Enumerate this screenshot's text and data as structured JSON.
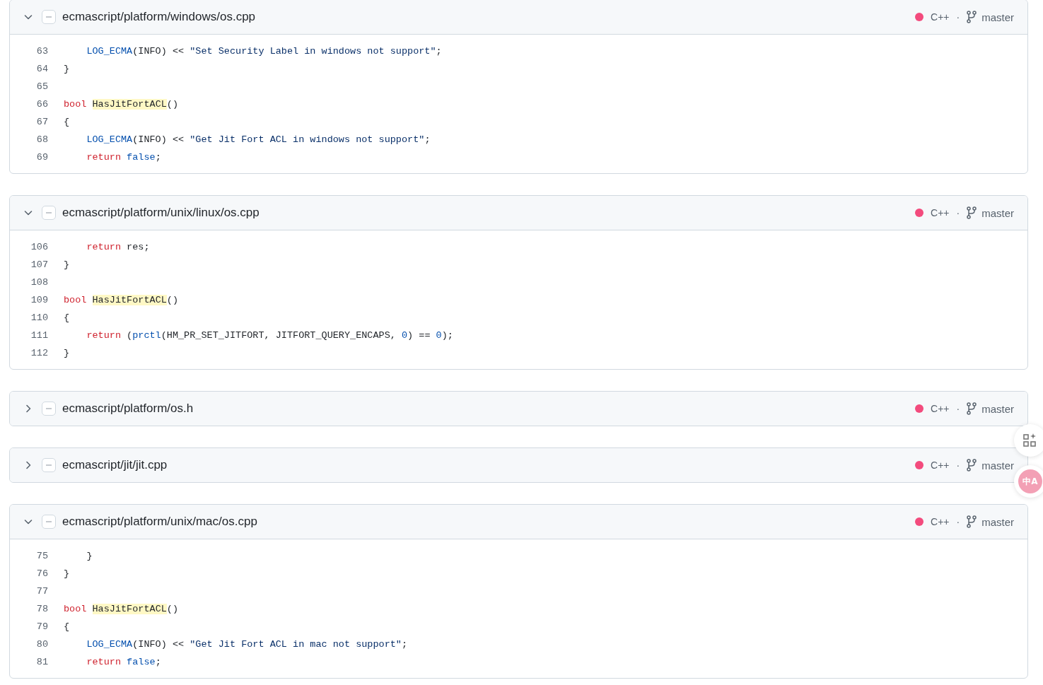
{
  "results": [
    {
      "path": "ecmascript/platform/windows/os.cpp",
      "expanded": true,
      "language": "C++",
      "separator": "·",
      "branch": "master",
      "lines": [
        {
          "number": "63",
          "indented": true,
          "tokens": [
            {
              "kind": "func",
              "text": "LOG_ECMA"
            },
            {
              "kind": "plain",
              "text": "(INFO) << "
            },
            {
              "kind": "string",
              "text": "\"Set Security Label in windows not support\""
            },
            {
              "kind": "plain",
              "text": ";"
            }
          ]
        },
        {
          "number": "64",
          "indented": false,
          "tokens": [
            {
              "kind": "plain",
              "text": "}"
            }
          ]
        },
        {
          "number": "65"
        },
        {
          "number": "66",
          "indented": false,
          "tokens": [
            {
              "kind": "keyword",
              "text": "bool "
            },
            {
              "kind": "match",
              "text": "HasJitFortACL"
            },
            {
              "kind": "plain",
              "text": "()"
            }
          ]
        },
        {
          "number": "67",
          "indented": false,
          "tokens": [
            {
              "kind": "plain",
              "text": "{"
            }
          ]
        },
        {
          "number": "68",
          "indented": true,
          "tokens": [
            {
              "kind": "func",
              "text": "LOG_ECMA"
            },
            {
              "kind": "plain",
              "text": "(INFO) << "
            },
            {
              "kind": "string",
              "text": "\"Get Jit Fort ACL in windows not support\""
            },
            {
              "kind": "plain",
              "text": ";"
            }
          ]
        },
        {
          "number": "69",
          "indented": true,
          "tokens": [
            {
              "kind": "keyword",
              "text": "return "
            },
            {
              "kind": "constant",
              "text": "false"
            },
            {
              "kind": "plain",
              "text": ";"
            }
          ]
        }
      ]
    },
    {
      "path": "ecmascript/platform/unix/linux/os.cpp",
      "expanded": true,
      "language": "C++",
      "separator": "·",
      "branch": "master",
      "lines": [
        {
          "number": "106",
          "indented": true,
          "tokens": [
            {
              "kind": "keyword",
              "text": "return"
            },
            {
              "kind": "plain",
              "text": " res;"
            }
          ]
        },
        {
          "number": "107",
          "indented": false,
          "tokens": [
            {
              "kind": "plain",
              "text": "}"
            }
          ]
        },
        {
          "number": "108"
        },
        {
          "number": "109",
          "indented": false,
          "tokens": [
            {
              "kind": "keyword",
              "text": "bool "
            },
            {
              "kind": "match",
              "text": "HasJitFortACL"
            },
            {
              "kind": "plain",
              "text": "()"
            }
          ]
        },
        {
          "number": "110",
          "indented": false,
          "tokens": [
            {
              "kind": "plain",
              "text": "{"
            }
          ]
        },
        {
          "number": "111",
          "indented": true,
          "tokens": [
            {
              "kind": "keyword",
              "text": "return"
            },
            {
              "kind": "plain",
              "text": " ("
            },
            {
              "kind": "func",
              "text": "prctl"
            },
            {
              "kind": "plain",
              "text": "(HM_PR_SET_JITFORT, JITFORT_QUERY_ENCAPS, "
            },
            {
              "kind": "constant",
              "text": "0"
            },
            {
              "kind": "plain",
              "text": ") == "
            },
            {
              "kind": "constant",
              "text": "0"
            },
            {
              "kind": "plain",
              "text": ");"
            }
          ]
        },
        {
          "number": "112",
          "indented": false,
          "tokens": [
            {
              "kind": "plain",
              "text": "}"
            }
          ]
        }
      ]
    },
    {
      "path": "ecmascript/platform/os.h",
      "expanded": false,
      "language": "C++",
      "separator": "·",
      "branch": "master"
    },
    {
      "path": "ecmascript/jit/jit.cpp",
      "expanded": false,
      "language": "C++",
      "separator": "·",
      "branch": "master"
    },
    {
      "path": "ecmascript/platform/unix/mac/os.cpp",
      "expanded": true,
      "language": "C++",
      "separator": "·",
      "branch": "master",
      "lines": [
        {
          "number": "75",
          "indented": true,
          "tokens": [
            {
              "kind": "plain",
              "text": "}"
            }
          ]
        },
        {
          "number": "76",
          "indented": false,
          "tokens": [
            {
              "kind": "plain",
              "text": "}"
            }
          ]
        },
        {
          "number": "77"
        },
        {
          "number": "78",
          "indented": false,
          "tokens": [
            {
              "kind": "keyword",
              "text": "bool "
            },
            {
              "kind": "match",
              "text": "HasJitFortACL"
            },
            {
              "kind": "plain",
              "text": "()"
            }
          ]
        },
        {
          "number": "79",
          "indented": false,
          "tokens": [
            {
              "kind": "plain",
              "text": "{"
            }
          ]
        },
        {
          "number": "80",
          "indented": true,
          "tokens": [
            {
              "kind": "func",
              "text": "LOG_ECMA"
            },
            {
              "kind": "plain",
              "text": "(INFO) << "
            },
            {
              "kind": "string",
              "text": "\"Get Jit Fort ACL in mac not support\""
            },
            {
              "kind": "plain",
              "text": ";"
            }
          ]
        },
        {
          "number": "81",
          "indented": true,
          "tokens": [
            {
              "kind": "keyword",
              "text": "return "
            },
            {
              "kind": "constant",
              "text": "false"
            },
            {
              "kind": "plain",
              "text": ";"
            }
          ]
        }
      ]
    }
  ],
  "floating_tools": {
    "translate_label": "中A"
  }
}
